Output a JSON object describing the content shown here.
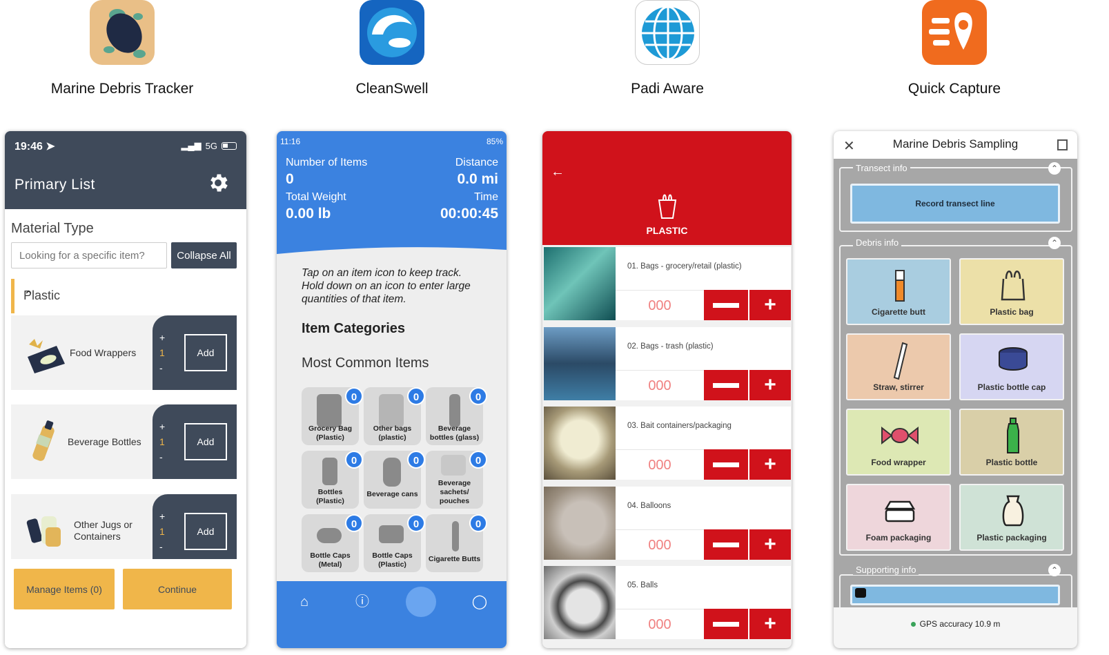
{
  "apps": [
    {
      "name": "Marine Debris Tracker"
    },
    {
      "name": "CleanSwell"
    },
    {
      "name": "Padi Aware"
    },
    {
      "name": "Quick Capture"
    }
  ],
  "mdt": {
    "status_time": "19:46",
    "status_network": "5G",
    "title": "Primary List",
    "icons": {
      "settings": "gear-icon",
      "location": "location-arrow-icon"
    },
    "material_type": "Material Type",
    "search_placeholder": "Looking for a specific item?",
    "collapse_all": "Collapse All",
    "category": "Plastic",
    "items": [
      {
        "label": "Food Wrappers",
        "count": "1",
        "add": "Add"
      },
      {
        "label": "Beverage Bottles",
        "count": "1",
        "add": "Add"
      },
      {
        "label_line1": "Other Jugs or",
        "label_line2": "Containers",
        "count": "1",
        "add": "Add"
      }
    ],
    "plus": "+",
    "minus": "-",
    "manage_items": "Manage Items (0)",
    "continue": "Continue",
    "colors": {
      "header": "#3f4a5a",
      "accent": "#f0b64a"
    }
  },
  "cs": {
    "status_time": "11:16",
    "battery": "85%",
    "number_of_items_label": "Number of Items",
    "number_of_items": "0",
    "distance_label": "Distance",
    "distance": "0.0 mi",
    "total_weight_label": "Total Weight",
    "total_weight": "0.00 lb",
    "time_label": "Time",
    "time": "00:00:45",
    "instructions_1": "Tap on an item icon to keep track.",
    "instructions_2": "Hold down on an icon to enter large",
    "instructions_3": "quantities of that item.",
    "item_categories": "Item Categories",
    "most_common": "Most Common Items",
    "tiles": [
      {
        "l1": "Grocery Bag",
        "l2": "(Plastic)",
        "count": "0"
      },
      {
        "l1": "Other bags",
        "l2": "(plastic)",
        "count": "0"
      },
      {
        "l1": "Beverage",
        "l2": "bottles (glass)",
        "count": "0"
      },
      {
        "l1": "Bottles",
        "l2": "(Plastic)",
        "count": "0"
      },
      {
        "l1": "Beverage cans",
        "l2": "",
        "count": "0"
      },
      {
        "l1": "Beverage",
        "l2": "sachets/",
        "l3": "pouches",
        "count": "0"
      },
      {
        "l1": "Bottle Caps",
        "l2": "(Metal)",
        "count": "0"
      },
      {
        "l1": "Bottle Caps",
        "l2": "(Plastic)",
        "count": "0"
      },
      {
        "l1": "Cigarette Butts",
        "l2": "",
        "count": "0"
      }
    ],
    "nav_icons": [
      "home-icon",
      "info-icon",
      "add-item-icon",
      "profile-icon"
    ],
    "colors": {
      "blue": "#3b82e0"
    }
  },
  "padi": {
    "title": "PLASTIC",
    "icons": {
      "back": "back-arrow-icon",
      "bag": "plastic-bag-icon"
    },
    "rows": [
      {
        "label": "01. Bags - grocery/retail (plastic)",
        "count": "000"
      },
      {
        "label": "02. Bags - trash (plastic)",
        "count": "000"
      },
      {
        "label": "03. Bait containers/packaging",
        "count": "000"
      },
      {
        "label": "04. Balloons",
        "count": "000"
      },
      {
        "label": "05. Balls",
        "count": "000"
      }
    ],
    "plus": "+",
    "colors": {
      "red": "#d0121b"
    }
  },
  "qc": {
    "title": "Marine Debris Sampling",
    "transect_info": "Transect info",
    "record_transect": "Record transect line",
    "debris_info": "Debris info",
    "cards": [
      {
        "label": "Cigarette butt",
        "color": "#a9cde0",
        "icon": "cigarette-icon"
      },
      {
        "label": "Plastic bag",
        "color": "#ece0a8",
        "icon": "plastic-bag-icon"
      },
      {
        "label": "Straw, stirrer",
        "color": "#ecc9ac",
        "icon": "straw-icon"
      },
      {
        "label": "Plastic bottle cap",
        "color": "#d6d6f2",
        "icon": "bottle-cap-icon"
      },
      {
        "label": "Food wrapper",
        "color": "#dde8b4",
        "icon": "candy-wrapper-icon"
      },
      {
        "label": "Plastic bottle",
        "color": "#d9cfa8",
        "icon": "bottle-icon"
      },
      {
        "label": "Foam packaging",
        "color": "#eed6db",
        "icon": "foam-container-icon"
      },
      {
        "label": "Plastic packaging",
        "color": "#cfe2d6",
        "icon": "packaging-icon"
      }
    ],
    "supporting_info": "Supporting info",
    "gps": "GPS accuracy 10.9 m",
    "icons": {
      "close": "close-icon",
      "map": "map-icon",
      "camera": "camera-icon"
    }
  }
}
